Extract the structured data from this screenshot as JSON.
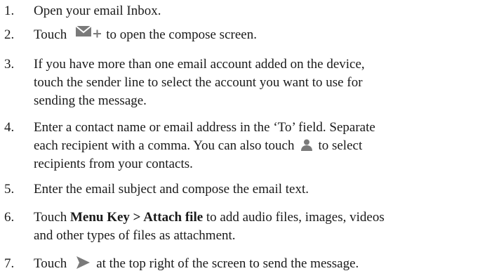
{
  "steps": [
    {
      "number": "1.",
      "lines": [
        "Open your email Inbox."
      ]
    },
    {
      "number": "2.",
      "before_icon": "Touch",
      "icon": "compose-icon",
      "after_icon": "to open the compose screen."
    },
    {
      "number": "3.",
      "lines": [
        "If you have more than one email account added on the device,",
        "touch the sender line to select the account you want to use for",
        "sending the message."
      ]
    },
    {
      "number": "4.",
      "lines": [
        "Enter a contact name or email address in the ‘To’ field. Separate",
        "each recipient with a comma. You can also touch"
      ],
      "icon": "person-icon",
      "line2_after_icon": "to select",
      "line3": "recipients from your contacts."
    },
    {
      "number": "5.",
      "lines": [
        "Enter the email subject and compose the email text."
      ]
    },
    {
      "number": "6.",
      "before_bold": "Touch",
      "bold": "Menu Key > Attach file",
      "after_bold": "to add audio files, images, videos",
      "line2": "and other types of files as attachment."
    },
    {
      "number": "7.",
      "before_icon": "Touch",
      "icon": "send-icon",
      "after_icon": "at the top right of the screen to send the message."
    }
  ],
  "colors": {
    "text": "#1a1a1a",
    "icon_gray": "#7a7a7a"
  }
}
